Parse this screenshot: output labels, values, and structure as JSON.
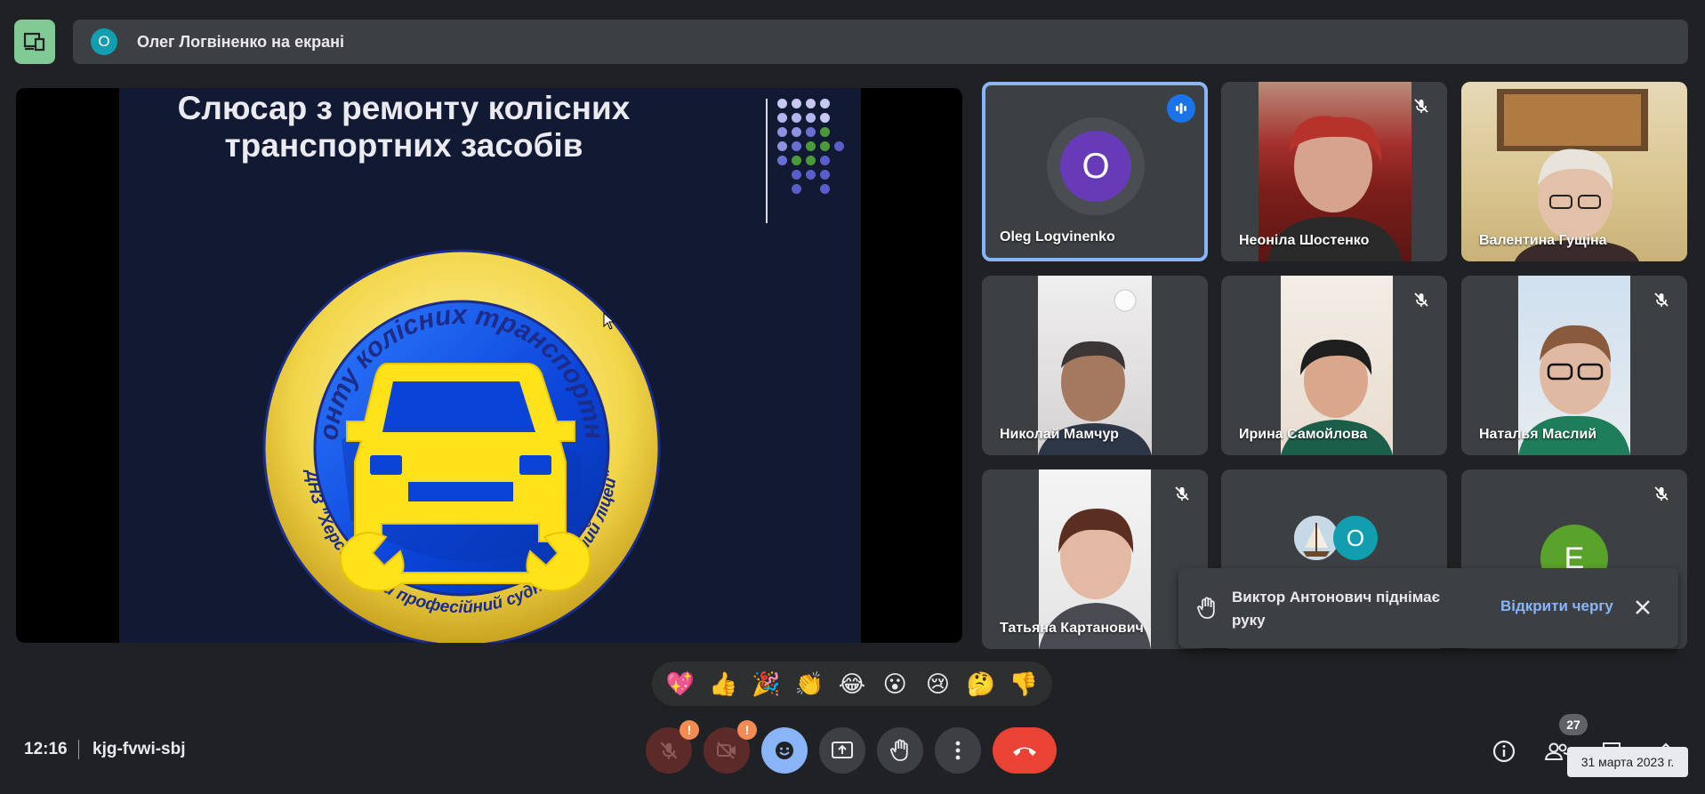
{
  "presenting_bar": {
    "avatar_letter": "О",
    "text": "Олег Логвіненко на екрані"
  },
  "slide": {
    "title_line1": "Слюсар з ремонту колісних",
    "title_line2": "транспортних засобів",
    "emblem_top_text": "НПЦ з ремонту колісних транспортних засобів",
    "emblem_bottom_text": "ДНЗ \"Херсонський професійний суднобудівний ліцей\""
  },
  "tiles": [
    {
      "name": "Oleg Logvinenko",
      "avatar": "O",
      "active": true,
      "muted": false
    },
    {
      "name": "Неоніла Шостенко",
      "muted": true
    },
    {
      "name": "Валентина Гущіна",
      "muted": false
    },
    {
      "name": "Николай Мамчур",
      "muted": false
    },
    {
      "name": "Ирина Самойлова",
      "muted": true
    },
    {
      "name": "Наталья Маслий",
      "muted": true
    },
    {
      "name": "Татьяна Картанович",
      "muted": true
    },
    {
      "name": "",
      "avatar": "O",
      "muted": false
    },
    {
      "name": "",
      "avatar": "E",
      "muted": true
    }
  ],
  "toast": {
    "text": "Виктор Антонович піднімає руку",
    "link": "Відкрити чергу"
  },
  "reactions": [
    "💖",
    "👍",
    "🎉",
    "👏",
    "😂",
    "😮",
    "😢",
    "🤔",
    "👎"
  ],
  "bottom": {
    "time": "12:16",
    "meeting_code": "kjg-fvwi-sbj",
    "participants_count": "27",
    "tooltip": "31 марта 2023 г.",
    "warn_badge": "!"
  },
  "colors": {
    "background": "#202124",
    "tile": "#3c4043",
    "accent": "#8ab4f8",
    "end_call": "#ea4335",
    "present_green": "#81c995"
  },
  "icons": [
    "present-screen-icon",
    "speaking-icon",
    "mic-off-icon",
    "raise-hand-icon",
    "close-icon",
    "emoji-icon",
    "present-icon",
    "hand-icon",
    "more-icon",
    "end-call-icon",
    "info-icon",
    "people-icon",
    "chat-icon",
    "activities-icon"
  ]
}
